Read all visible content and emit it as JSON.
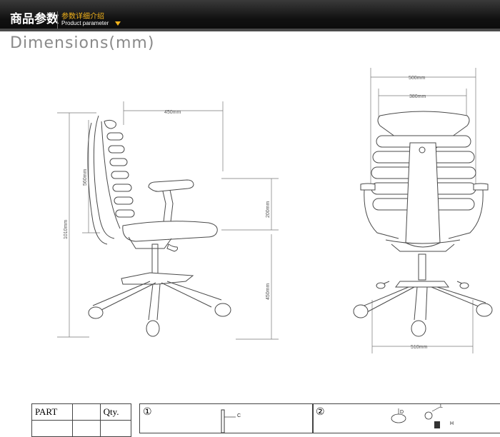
{
  "header": {
    "title_cn": "商品参数",
    "subtitle_cn": "参数详细介绍",
    "subtitle_en": "Product parameter"
  },
  "heading": "Dimensions(mm)",
  "side_view": {
    "dims": {
      "depth": "450mm",
      "back_height": "560mm",
      "total_height": "1010mm",
      "arm_height": "200mm",
      "seat_height": "450mm"
    }
  },
  "front_view": {
    "dims": {
      "outer_width": "500mm",
      "back_width": "380mm",
      "base_width": "510mm"
    }
  },
  "parts": {
    "table": {
      "part_label": "PART",
      "qty_label": "Qty."
    },
    "box1": {
      "number": "①",
      "label_c": "C"
    },
    "box2": {
      "number": "②",
      "label_d": "D",
      "label_l": "L",
      "label_h": "H"
    }
  }
}
